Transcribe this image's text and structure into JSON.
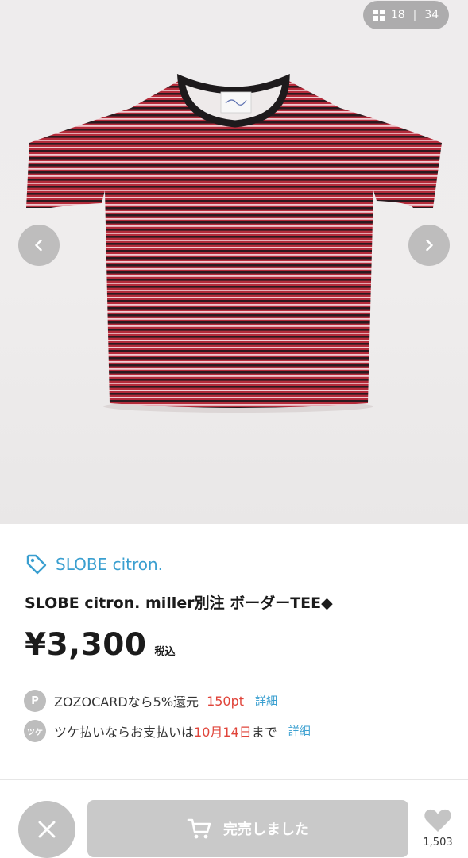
{
  "gallery": {
    "current": "18",
    "separator": "|",
    "total": "34"
  },
  "product": {
    "brand": "SLOBE citron.",
    "title": "SLOBE citron. miller別注 ボーダーTEE◆",
    "price": "¥3,300",
    "tax_label": "税込"
  },
  "points_row": {
    "badge": "P",
    "text": "ZOZOCARDなら5%還元",
    "points": "150pt",
    "link": "詳細"
  },
  "tsuke_row": {
    "badge": "ツケ",
    "text_before": "ツケ払いならお支払いは",
    "date": "10月14日",
    "text_after": "まで",
    "link": "詳細"
  },
  "bottom_bar": {
    "soldout_label": "完売しました",
    "like_count": "1,503"
  },
  "colors": {
    "accent_blue": "#3a9fd0",
    "highlight_red": "#e0443a",
    "disabled_gray": "#c9c9c9"
  }
}
